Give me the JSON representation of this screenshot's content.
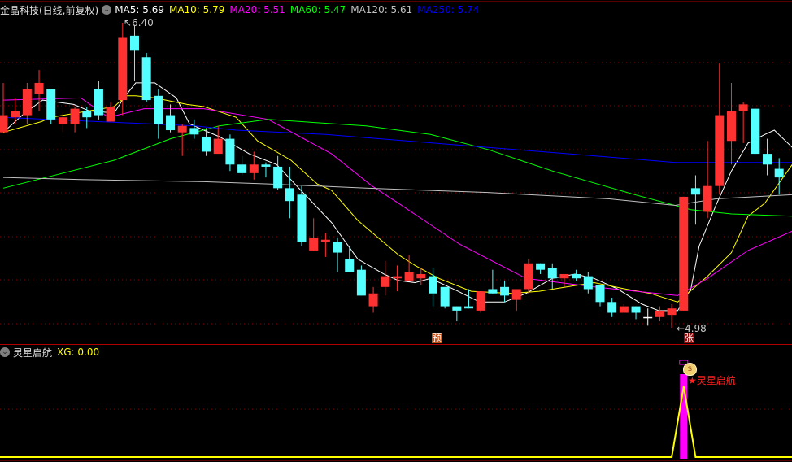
{
  "header": {
    "title": "金晶科技(日线,前复权)",
    "menu_icon": "chevron-down-circle-icon",
    "ma": [
      {
        "label": "MA5: 5.69",
        "color": "#ffffff"
      },
      {
        "label": "MA10: 5.79",
        "color": "#ffff00"
      },
      {
        "label": "MA20: 5.51",
        "color": "#ff00ff"
      },
      {
        "label": "MA60: 5.47",
        "color": "#00ff00"
      },
      {
        "label": "MA120: 5.61",
        "color": "#c0c0c0"
      },
      {
        "label": "MA250: 5.74",
        "color": "#0000ff"
      }
    ]
  },
  "price_labels": {
    "high": "6.40",
    "low": "4.98"
  },
  "markers": {
    "pre": "预",
    "rise": "张"
  },
  "sub_panel": {
    "title": "灵星启航",
    "xg_label": "XG: 0.00",
    "signal_text": "★灵星启航",
    "signal_icon": "money-bag-icon"
  },
  "colors": {
    "up": "#ff3232",
    "down": "#54ffff",
    "grid": "#8b0000",
    "xg_line": "#ffff00",
    "xg_bar": "#ff00ff"
  },
  "chart_data": {
    "type": "candlestick",
    "price_range": [
      4.98,
      6.4
    ],
    "candles": [
      [
        5.89,
        6.12,
        5.89,
        5.97
      ],
      [
        5.96,
        6.05,
        5.93,
        5.99
      ],
      [
        5.97,
        6.12,
        5.93,
        6.09
      ],
      [
        6.07,
        6.18,
        5.99,
        6.12
      ],
      [
        6.09,
        6.09,
        5.93,
        5.95
      ],
      [
        5.93,
        5.98,
        5.89,
        5.96
      ],
      [
        5.93,
        6.01,
        5.89,
        6.0
      ],
      [
        5.99,
        6.01,
        5.91,
        5.96
      ],
      [
        6.09,
        6.13,
        5.95,
        5.97
      ],
      [
        5.94,
        6.03,
        5.94,
        6.01
      ],
      [
        6.04,
        6.4,
        5.97,
        6.33
      ],
      [
        6.34,
        6.39,
        6.13,
        6.27
      ],
      [
        6.24,
        6.26,
        6.03,
        6.04
      ],
      [
        6.06,
        6.09,
        5.86,
        5.93
      ],
      [
        5.97,
        6.02,
        5.89,
        5.9
      ],
      [
        5.89,
        5.93,
        5.78,
        5.92
      ],
      [
        5.91,
        5.95,
        5.86,
        5.88
      ],
      [
        5.87,
        5.91,
        5.78,
        5.8
      ],
      [
        5.79,
        5.92,
        5.79,
        5.86
      ],
      [
        5.86,
        5.88,
        5.71,
        5.74
      ],
      [
        5.74,
        5.78,
        5.69,
        5.7
      ],
      [
        5.7,
        5.8,
        5.67,
        5.74
      ],
      [
        5.74,
        5.75,
        5.68,
        5.73
      ],
      [
        5.73,
        5.78,
        5.62,
        5.63
      ],
      [
        5.63,
        5.73,
        5.49,
        5.57
      ],
      [
        5.6,
        5.64,
        5.36,
        5.38
      ],
      [
        5.34,
        5.49,
        5.34,
        5.4
      ],
      [
        5.38,
        5.42,
        5.31,
        5.39
      ],
      [
        5.38,
        5.4,
        5.24,
        5.33
      ],
      [
        5.3,
        5.36,
        5.24,
        5.24
      ],
      [
        5.25,
        5.27,
        5.13,
        5.13
      ],
      [
        5.08,
        5.17,
        5.05,
        5.14
      ],
      [
        5.17,
        5.29,
        5.13,
        5.22
      ],
      [
        5.21,
        5.27,
        5.15,
        5.22
      ],
      [
        5.2,
        5.32,
        5.2,
        5.24
      ],
      [
        5.21,
        5.26,
        5.18,
        5.23
      ],
      [
        5.22,
        5.26,
        5.08,
        5.14
      ],
      [
        5.17,
        5.17,
        5.07,
        5.08
      ],
      [
        5.08,
        5.08,
        5.01,
        5.06
      ],
      [
        5.08,
        5.16,
        5.07,
        5.07
      ],
      [
        5.06,
        5.15,
        5.05,
        5.15
      ],
      [
        5.16,
        5.25,
        5.14,
        5.14
      ],
      [
        5.17,
        5.2,
        5.1,
        5.13
      ],
      [
        5.11,
        5.16,
        5.06,
        5.16
      ],
      [
        5.16,
        5.3,
        5.14,
        5.28
      ],
      [
        5.28,
        5.28,
        5.23,
        5.25
      ],
      [
        5.26,
        5.28,
        5.16,
        5.21
      ],
      [
        5.21,
        5.23,
        5.17,
        5.23
      ],
      [
        5.23,
        5.25,
        5.2,
        5.21
      ],
      [
        5.22,
        5.24,
        5.14,
        5.16
      ],
      [
        5.18,
        5.18,
        5.08,
        5.1
      ],
      [
        5.1,
        5.12,
        5.03,
        5.05
      ],
      [
        5.05,
        5.09,
        5.05,
        5.08
      ],
      [
        5.08,
        5.08,
        5.02,
        5.05
      ],
      [
        5.03,
        5.07,
        4.99,
        5.03
      ],
      [
        5.03,
        5.08,
        5.01,
        5.06
      ],
      [
        5.04,
        5.09,
        4.98,
        5.07
      ],
      [
        5.06,
        5.59,
        5.06,
        5.59
      ],
      [
        5.63,
        5.69,
        5.46,
        5.6
      ],
      [
        5.52,
        5.85,
        5.49,
        5.64
      ],
      [
        5.64,
        6.21,
        5.6,
        5.97
      ],
      [
        5.85,
        6.12,
        5.74,
        5.99
      ],
      [
        5.99,
        6.03,
        5.84,
        6.02
      ],
      [
        6.0,
        6.0,
        5.79,
        5.79
      ],
      [
        5.79,
        5.86,
        5.69,
        5.74
      ],
      [
        5.72,
        5.77,
        5.6,
        5.68
      ]
    ],
    "ma_lines": [
      {
        "name": "MA5",
        "color": "#ffffff",
        "points": [
          [
            0,
            5.89
          ],
          [
            1.8,
            5.98
          ],
          [
            3.3,
            6.04
          ],
          [
            5.9,
            6.02
          ],
          [
            7.2,
            5.99
          ],
          [
            9.3,
            5.98
          ],
          [
            10.1,
            6.05
          ],
          [
            11.1,
            6.12
          ],
          [
            12.7,
            6.12
          ],
          [
            14.5,
            6.05
          ],
          [
            15.6,
            5.93
          ],
          [
            16.8,
            5.9
          ],
          [
            18.1,
            5.87
          ],
          [
            20.6,
            5.79
          ],
          [
            22.9,
            5.74
          ],
          [
            25.1,
            5.61
          ],
          [
            27.5,
            5.47
          ],
          [
            29.7,
            5.3
          ],
          [
            31.9,
            5.23
          ],
          [
            33.1,
            5.2
          ],
          [
            34.5,
            5.19
          ],
          [
            35.8,
            5.21
          ],
          [
            38.1,
            5.15
          ],
          [
            39.9,
            5.1
          ],
          [
            42,
            5.1
          ],
          [
            43.8,
            5.14
          ],
          [
            46,
            5.21
          ],
          [
            47.9,
            5.23
          ],
          [
            49.5,
            5.21
          ],
          [
            51.5,
            5.16
          ],
          [
            53.5,
            5.09
          ],
          [
            54.9,
            5.06
          ],
          [
            56.5,
            5.06
          ],
          [
            57.6,
            5.16
          ],
          [
            58.3,
            5.36
          ],
          [
            59.7,
            5.55
          ],
          [
            61,
            5.71
          ],
          [
            62.4,
            5.84
          ],
          [
            63.8,
            5.88
          ],
          [
            64.6,
            5.9
          ],
          [
            66.1,
            5.82
          ]
        ]
      },
      {
        "name": "MA10",
        "color": "#ffff00",
        "points": [
          [
            0,
            5.89
          ],
          [
            3.2,
            5.94
          ],
          [
            4,
            5.96
          ],
          [
            7.2,
            5.99
          ],
          [
            9.3,
            6.01
          ],
          [
            10.3,
            6.06
          ],
          [
            11.1,
            6.06
          ],
          [
            12.7,
            6.05
          ],
          [
            15.4,
            6.02
          ],
          [
            16.8,
            6.01
          ],
          [
            19.5,
            5.96
          ],
          [
            21.3,
            5.85
          ],
          [
            24.1,
            5.76
          ],
          [
            26.3,
            5.65
          ],
          [
            27.5,
            5.62
          ],
          [
            29.7,
            5.48
          ],
          [
            33.1,
            5.32
          ],
          [
            34.5,
            5.27
          ],
          [
            36.5,
            5.21
          ],
          [
            39.2,
            5.15
          ],
          [
            42.6,
            5.14
          ],
          [
            44.9,
            5.15
          ],
          [
            47.2,
            5.17
          ],
          [
            49.5,
            5.19
          ],
          [
            52.2,
            5.16
          ],
          [
            54.2,
            5.14
          ],
          [
            56.5,
            5.1
          ],
          [
            59,
            5.22
          ],
          [
            61,
            5.33
          ],
          [
            62.4,
            5.5
          ],
          [
            63.8,
            5.56
          ],
          [
            66.1,
            5.74
          ]
        ]
      },
      {
        "name": "MA20",
        "color": "#ff00ff",
        "points": [
          [
            0,
            6.04
          ],
          [
            6.5,
            6.05
          ],
          [
            8.8,
            5.96
          ],
          [
            11.8,
            6.0
          ],
          [
            16.8,
            6.0
          ],
          [
            22.2,
            5.95
          ],
          [
            27.5,
            5.79
          ],
          [
            30.9,
            5.64
          ],
          [
            33.1,
            5.56
          ],
          [
            38.2,
            5.37
          ],
          [
            43.8,
            5.21
          ],
          [
            49.5,
            5.17
          ],
          [
            56.5,
            5.13
          ],
          [
            59,
            5.21
          ],
          [
            62.4,
            5.34
          ],
          [
            66.1,
            5.43
          ]
        ]
      },
      {
        "name": "MA60",
        "color": "#00ff00",
        "points": [
          [
            0,
            5.63
          ],
          [
            9.3,
            5.76
          ],
          [
            14,
            5.86
          ],
          [
            18.1,
            5.92
          ],
          [
            22.2,
            5.95
          ],
          [
            30.4,
            5.92
          ],
          [
            35.8,
            5.88
          ],
          [
            40.6,
            5.81
          ],
          [
            46,
            5.71
          ],
          [
            52.9,
            5.6
          ],
          [
            57.6,
            5.53
          ],
          [
            61,
            5.51
          ],
          [
            66.1,
            5.5
          ]
        ]
      },
      {
        "name": "MA120",
        "color": "#c0c0c0",
        "points": [
          [
            0,
            5.68
          ],
          [
            6.5,
            5.67
          ],
          [
            16.8,
            5.66
          ],
          [
            22.2,
            5.65
          ],
          [
            30.4,
            5.63
          ],
          [
            40.6,
            5.61
          ],
          [
            50.8,
            5.58
          ],
          [
            56.3,
            5.55
          ],
          [
            59.7,
            5.58
          ],
          [
            66.1,
            5.6
          ]
        ]
      },
      {
        "name": "MA250",
        "color": "#0000ff",
        "points": [
          [
            0,
            5.96
          ],
          [
            3.8,
            5.95
          ],
          [
            7.9,
            5.94
          ],
          [
            16.1,
            5.92
          ],
          [
            19.5,
            5.9
          ],
          [
            27,
            5.88
          ],
          [
            33.8,
            5.85
          ],
          [
            40.6,
            5.82
          ],
          [
            47.4,
            5.79
          ],
          [
            56.3,
            5.75
          ],
          [
            66.1,
            5.75
          ]
        ]
      }
    ],
    "xg": {
      "signal_index": 57,
      "range": [
        0,
        1
      ],
      "value": 0.0
    }
  }
}
